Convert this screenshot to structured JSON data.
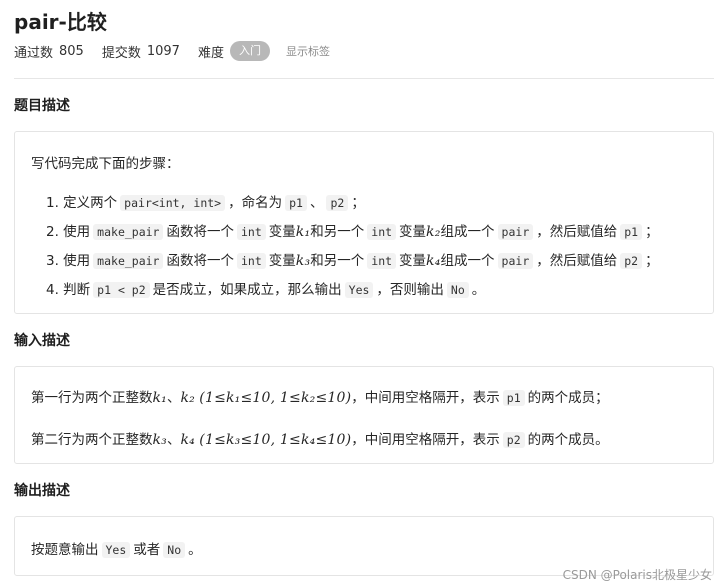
{
  "header": {
    "title": "pair-比较",
    "accepted_label": "通过数",
    "accepted_value": "805",
    "submit_label": "提交数",
    "submit_value": "1097",
    "difficulty_label": "难度",
    "difficulty_value": "入门",
    "show_tags": "显示标签"
  },
  "sections": {
    "description": {
      "title": "题目描述",
      "intro": "写代码完成下面的步骤：",
      "step1": {
        "n": "1. ",
        "a": "定义两个",
        "c1": "pair<int, int>",
        "b": "，命名为",
        "c2": "p1",
        "sep": "、",
        "c3": "p2",
        "end": "；"
      },
      "step2": {
        "n": "2. ",
        "a": "使用",
        "c1": "make_pair",
        "b": "函数将一个",
        "c2": "int",
        "d": "变量",
        "m1": "k₁",
        "e": "和另一个",
        "c3": "int",
        "f": "变量",
        "m2": "k₂",
        "g": "组成一个",
        "c4": "pair",
        "h": "，然后赋值给",
        "c5": "p1",
        "end": "；"
      },
      "step3": {
        "n": "3. ",
        "a": "使用",
        "c1": "make_pair",
        "b": "函数将一个",
        "c2": "int",
        "d": "变量",
        "m1": "k₃",
        "e": "和另一个",
        "c3": "int",
        "f": "变量",
        "m2": "k₄",
        "g": "组成一个",
        "c4": "pair",
        "h": "，然后赋值给",
        "c5": "p2",
        "end": "；"
      },
      "step4": {
        "n": "4. ",
        "a": "判断",
        "c1": "p1 < p2",
        "b": "是否成立，如果成立，那么输出",
        "c2": "Yes",
        "c": "，否则输出",
        "c3": "No",
        "end": "。"
      }
    },
    "input": {
      "title": "输入描述",
      "line1": {
        "a": "第一行为两个正整数",
        "m1": "k₁",
        "sep": "、",
        "m2": "k₂",
        "m3": "(1≤k₁≤10, 1≤k₂≤10)",
        "b": "，中间用空格隔开，表示",
        "c1": "p1",
        "end": "的两个成员；"
      },
      "line2": {
        "a": "第二行为两个正整数",
        "m1": "k₃",
        "sep": "、",
        "m2": "k₄",
        "m3": "(1≤k₃≤10, 1≤k₄≤10)",
        "b": "，中间用空格隔开，表示",
        "c1": "p2",
        "end": "的两个成员。"
      }
    },
    "output": {
      "title": "输出描述",
      "line": {
        "a": "按题意输出",
        "c1": "Yes",
        "b": "或者",
        "c2": "No",
        "end": "。"
      }
    }
  },
  "watermark": "CSDN @Polaris北极星少女"
}
